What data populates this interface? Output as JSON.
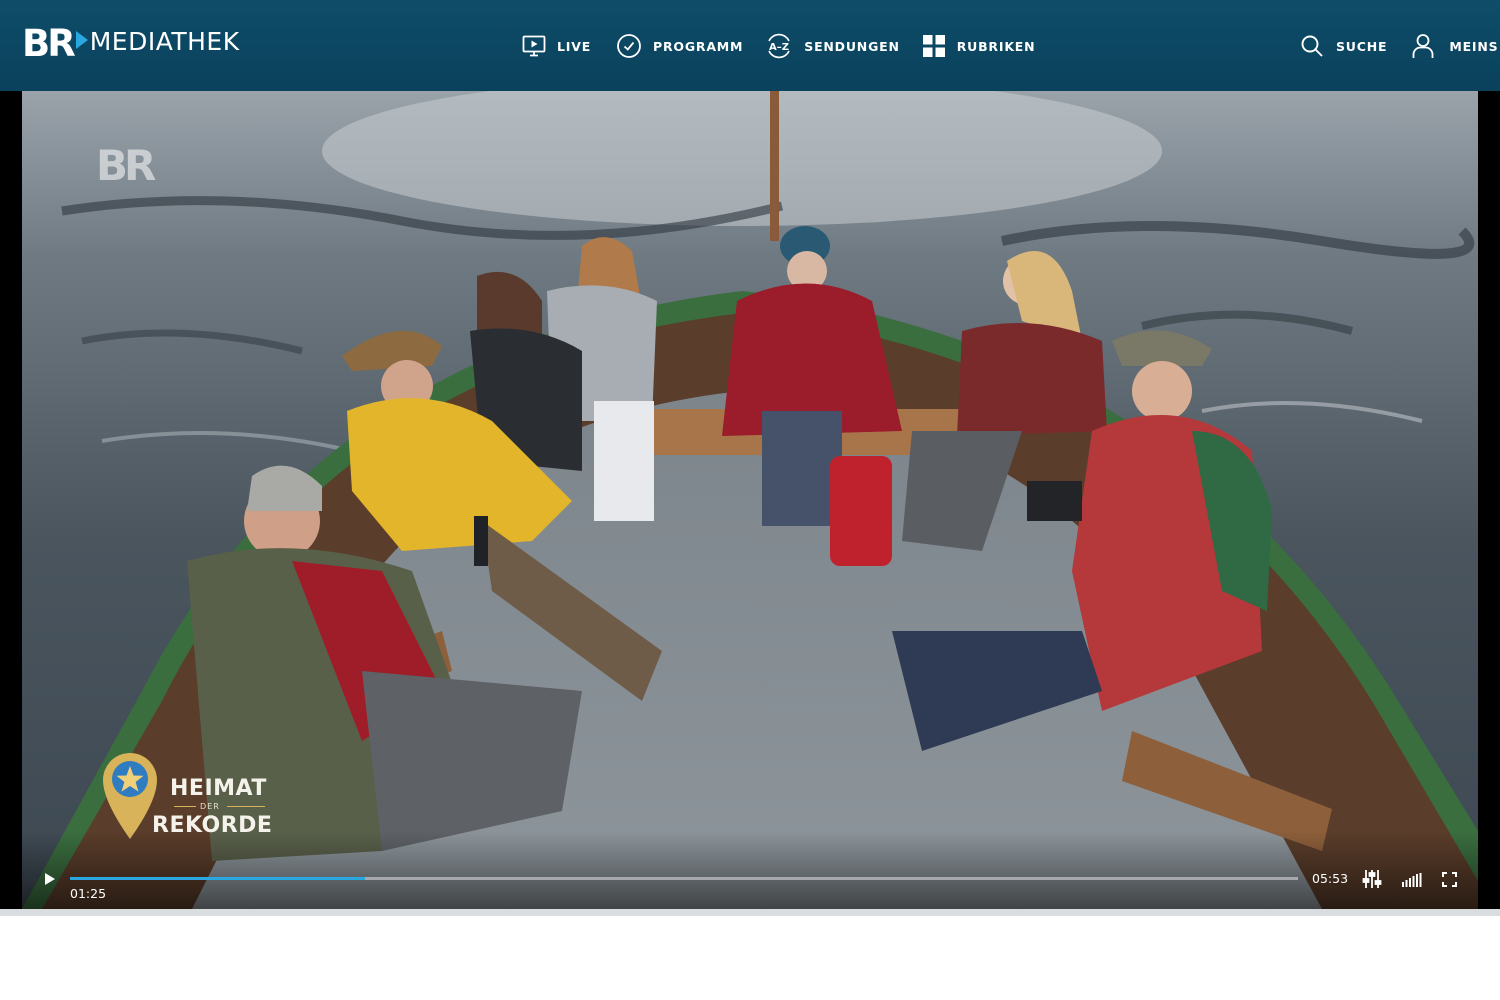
{
  "header": {
    "logo_br": "BR",
    "logo_word": "MEDIATHEK",
    "nav": [
      {
        "label": "LIVE",
        "icon": "tv-play-icon"
      },
      {
        "label": "PROGRAMM",
        "icon": "clock-check-icon"
      },
      {
        "label": "SENDUNGEN",
        "icon": "a-z-icon"
      },
      {
        "label": "RUBRIKEN",
        "icon": "grid-icon"
      }
    ],
    "search_label": "SUCHE",
    "account_label": "MEINS"
  },
  "video": {
    "watermark": "BR",
    "show_title_line1": "HEIMAT",
    "show_title_connector": "DER",
    "show_title_line2": "REKORDE",
    "current_time": "01:25",
    "duration": "05:53",
    "progress_fraction": 0.24
  },
  "colors": {
    "header_bg": "#0e4d69",
    "accent": "#2aa6e0",
    "show_logo_gold": "#d8b35a"
  }
}
